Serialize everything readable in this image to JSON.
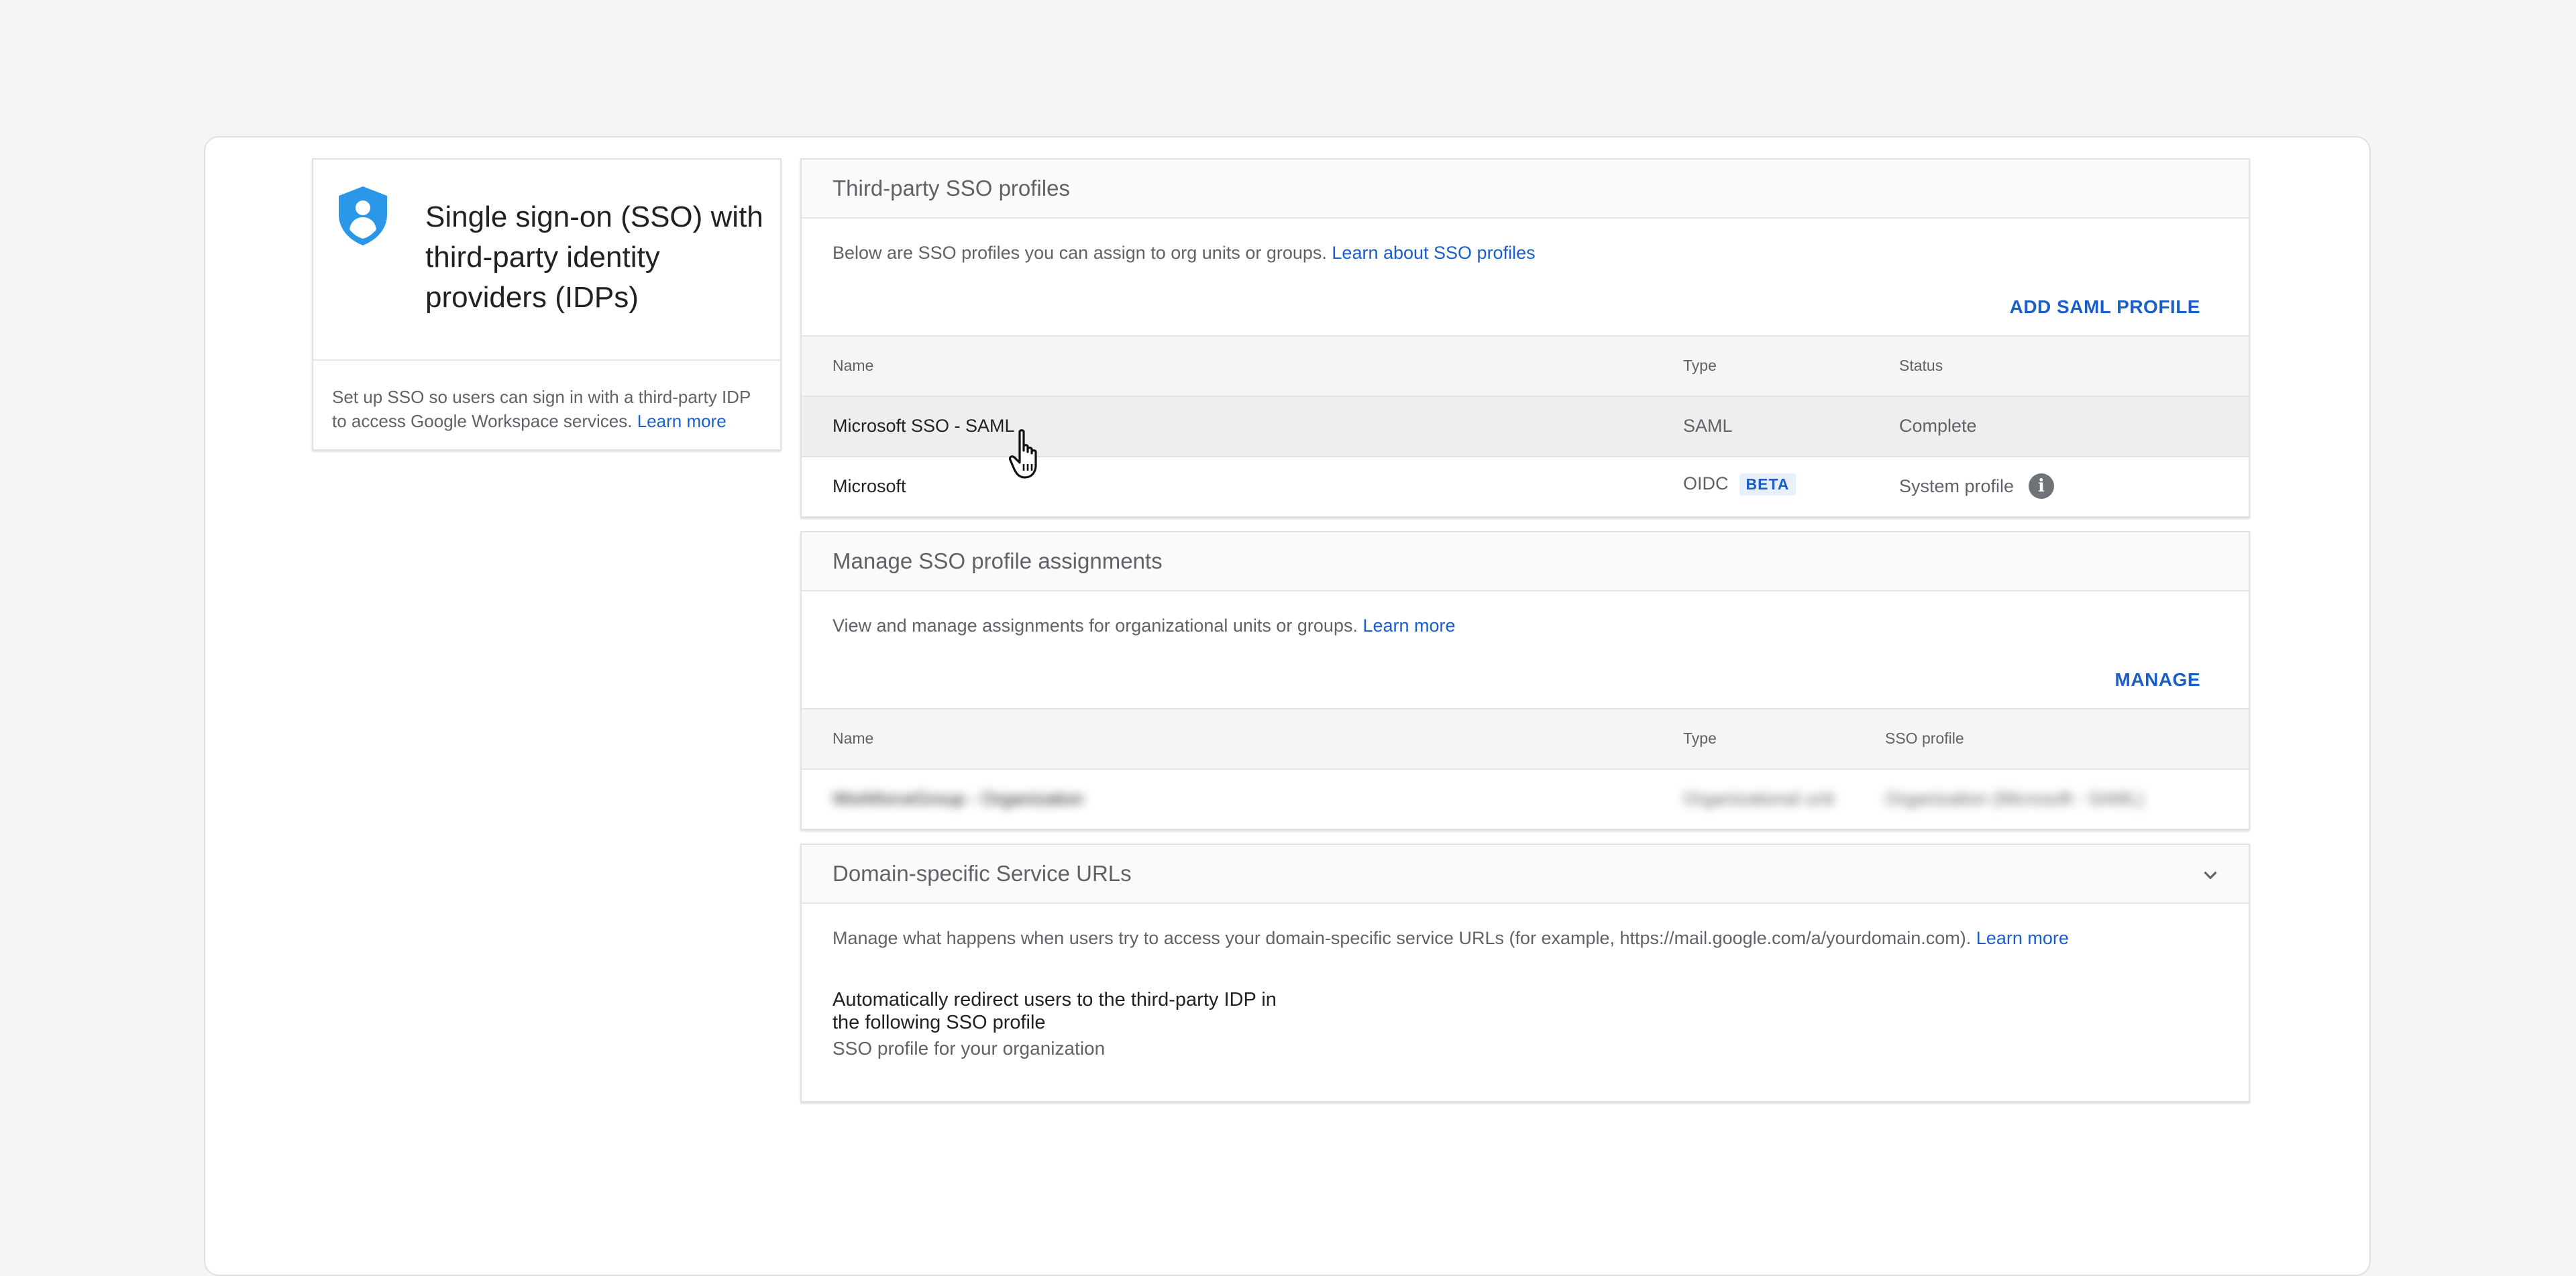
{
  "intro": {
    "title": "Single sign-on (SSO) with third-party identity providers (IDPs)",
    "description": "Set up SSO so users can sign in with a third-party IDP to access Google Workspace services.",
    "learn_more": "Learn more",
    "icon": "shield-user-icon"
  },
  "profiles": {
    "title": "Third-party SSO profiles",
    "description": "Below are SSO profiles you can assign to org units or groups.",
    "learn_link": "Learn about SSO profiles",
    "add_button": "ADD SAML PROFILE",
    "columns": [
      "Name",
      "Type",
      "Status"
    ],
    "rows": [
      {
        "name": "Microsoft SSO - SAML",
        "type": "SAML",
        "badge": "",
        "status": "Complete"
      },
      {
        "name": "Microsoft",
        "type": "OIDC",
        "badge": "BETA",
        "status": "System profile"
      }
    ]
  },
  "assignments": {
    "title": "Manage SSO profile assignments",
    "description": "View and manage assignments for organizational units or groups.",
    "learn_more": "Learn more",
    "manage_button": "MANAGE",
    "columns": [
      "Name",
      "Type",
      "SSO profile"
    ],
    "rows": [
      {
        "name": "WorkforceGroup - Organization",
        "type": "Organizational unit",
        "profile": "Organization (Microsoft - SAML)"
      }
    ]
  },
  "urls": {
    "title": "Domain-specific Service URLs",
    "description": "Manage what happens when users try to access your domain-specific service URLs (for example, https://mail.google.com/a/yourdomain.com).",
    "learn_more": "Learn more",
    "setting_title": "Automatically redirect users to the third-party IDP in the following SSO profile",
    "setting_subtitle": "SSO profile for your organization"
  },
  "colors": {
    "accent": "#1a5fc7",
    "shield": "#2a97e8",
    "background": "#f4f5f7"
  }
}
